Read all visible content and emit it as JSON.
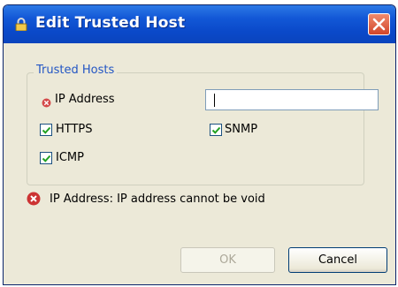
{
  "window": {
    "title": "Edit Trusted Host",
    "title_color": "#ffffff",
    "titlebar_color": "#0a49c9",
    "close_color": "#d2452a"
  },
  "group": {
    "legend": "Trusted Hosts",
    "legend_color": "#2356c4"
  },
  "fields": {
    "ip_label": "IP Address",
    "ip_value": "",
    "ip_error_icon": "error-icon"
  },
  "checkboxes": [
    {
      "label": "HTTPS",
      "checked": true
    },
    {
      "label": "SNMP",
      "checked": true
    },
    {
      "label": "ICMP",
      "checked": true
    }
  ],
  "validation": {
    "message": "IP Address: IP address cannot be void",
    "icon": "error-icon",
    "icon_color": "#cc3333"
  },
  "buttons": {
    "ok_label": "OK",
    "ok_enabled": false,
    "cancel_label": "Cancel"
  }
}
